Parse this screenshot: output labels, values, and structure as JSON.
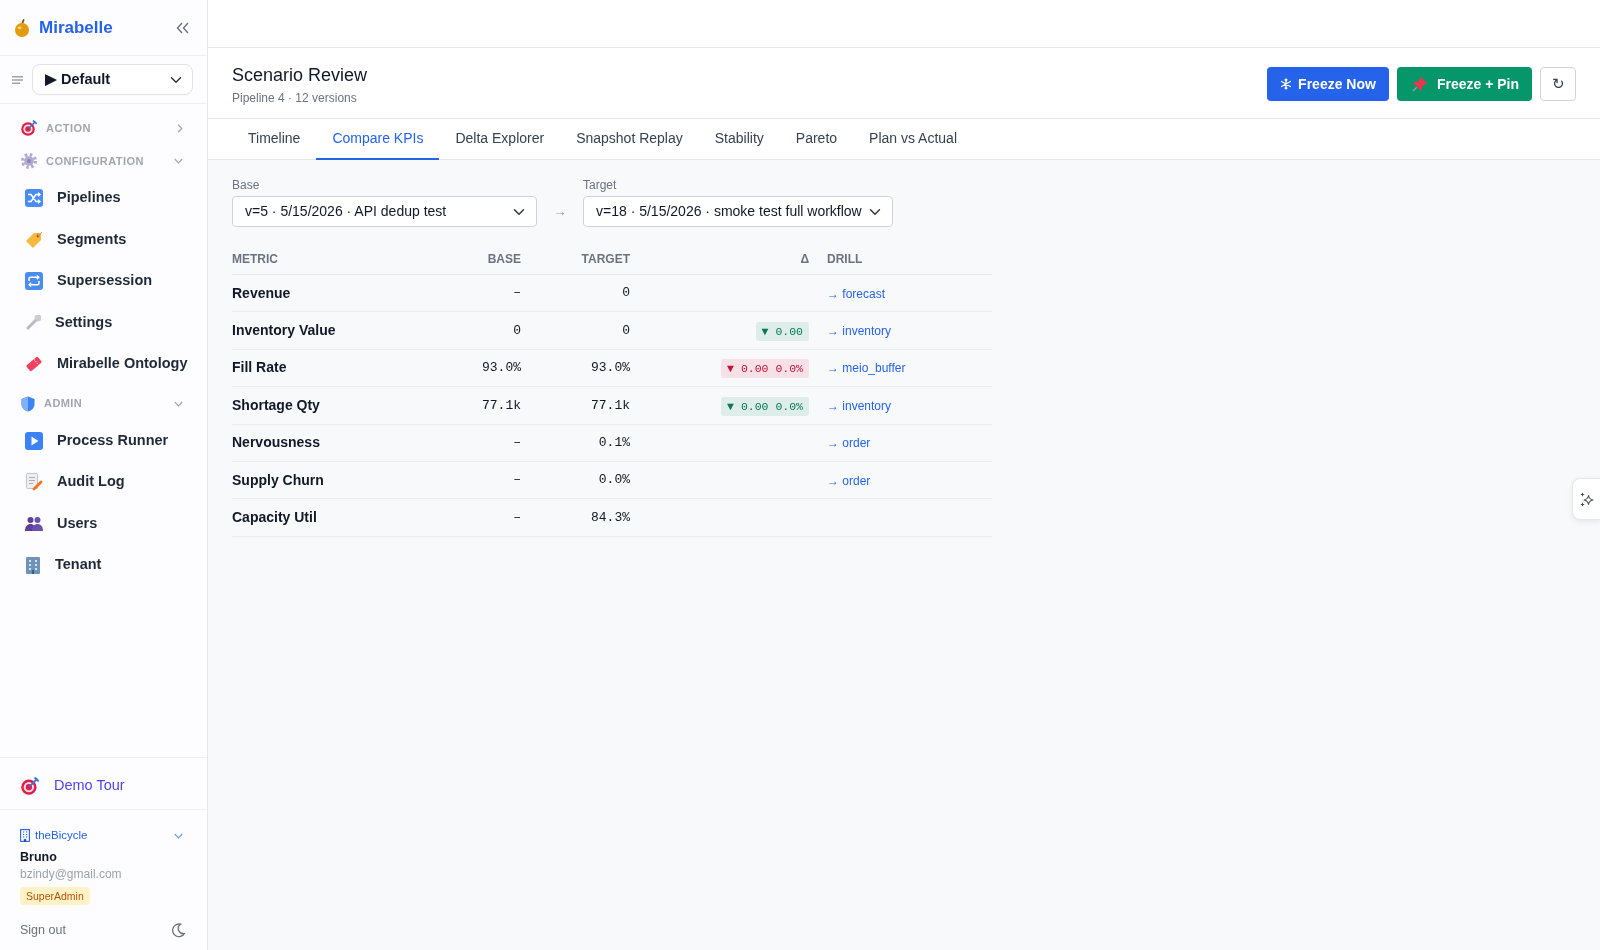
{
  "sidebar": {
    "brand": "Mirabelle",
    "workspace": {
      "value": "▶ Default"
    },
    "sections": [
      {
        "label": "ACTION",
        "expanded": false
      },
      {
        "label": "CONFIGURATION",
        "expanded": true,
        "children": [
          {
            "label": "Pipelines"
          },
          {
            "label": "Segments"
          },
          {
            "label": "Supersession"
          },
          {
            "label": "Settings"
          },
          {
            "label": "Mirabelle Ontology"
          }
        ]
      },
      {
        "label": "ADMIN",
        "expanded": true,
        "children": [
          {
            "label": "Process Runner"
          },
          {
            "label": "Audit Log"
          },
          {
            "label": "Users"
          },
          {
            "label": "Tenant"
          }
        ]
      }
    ],
    "demo_tour": "Demo Tour",
    "account": {
      "tenant": "theBicycle",
      "name": "Bruno",
      "email": "bzindy@gmail.com",
      "role": "SuperAdmin",
      "sign_out": "Sign out"
    }
  },
  "header": {
    "title": "Scenario Review",
    "subtitle": "Pipeline 4 · 12 versions",
    "buttons": [
      {
        "label": "Freeze Now",
        "kind": "primary"
      },
      {
        "label": "Freeze + Pin",
        "kind": "success"
      },
      {
        "label": "↻",
        "kind": "outline"
      }
    ]
  },
  "tabs": [
    {
      "label": "Timeline",
      "selected": false
    },
    {
      "label": "Compare KPIs",
      "selected": true
    },
    {
      "label": "Delta Explorer",
      "selected": false
    },
    {
      "label": "Snapshot Replay",
      "selected": false
    },
    {
      "label": "Stability",
      "selected": false
    },
    {
      "label": "Pareto",
      "selected": false
    },
    {
      "label": "Plan vs Actual",
      "selected": false
    }
  ],
  "compare": {
    "base": {
      "label": "Base",
      "value": "v=5 · 5/15/2026 · API dedup test"
    },
    "arrow": "→",
    "target": {
      "label": "Target",
      "value": "v=18 · 5/15/2026 · smoke test full workflow"
    }
  },
  "table": {
    "columns": [
      "METRIC",
      "BASE",
      "TARGET",
      "Δ",
      "DRILL"
    ],
    "rows": [
      {
        "metric": "Revenue",
        "base": "–",
        "target": "0",
        "drill": "→ forecast"
      },
      {
        "metric": "Inventory Value",
        "base": "0",
        "target": "0",
        "delta": {
          "text": "▼ 0.00",
          "color": "#047857"
        },
        "drill": "→ inventory"
      },
      {
        "metric": "Fill Rate",
        "base": "93.0%",
        "target": "93.0%",
        "delta": {
          "text": "▼ 0.00 0.0%",
          "color": "#be123c"
        },
        "drill": "→ meio_buffer"
      },
      {
        "metric": "Shortage Qty",
        "base": "77.1k",
        "target": "77.1k",
        "delta": {
          "text": "▼ 0.00 0.0%",
          "color": "#047857"
        },
        "drill": "→ inventory"
      },
      {
        "metric": "Nervousness",
        "base": "–",
        "target": "0.1%",
        "drill": "→ order"
      },
      {
        "metric": "Supply Churn",
        "base": "–",
        "target": "0.0%",
        "drill": "→ order"
      },
      {
        "metric": "Capacity Util",
        "base": "–",
        "target": "84.3%"
      }
    ]
  }
}
